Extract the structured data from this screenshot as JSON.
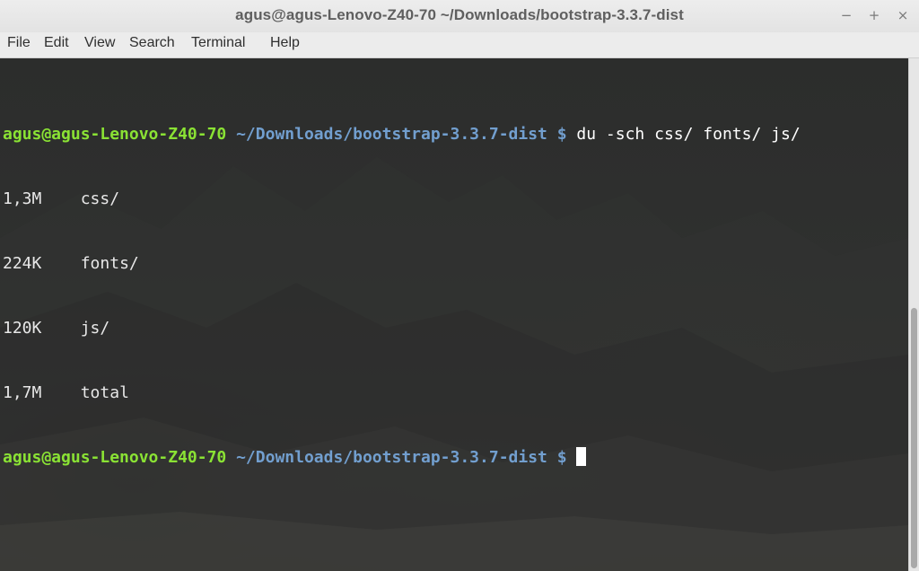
{
  "window": {
    "title": "agus@agus-Lenovo-Z40-70 ~/Downloads/bootstrap-3.3.7-dist",
    "controls": {
      "minimize": "−",
      "maximize": "+",
      "close": "×"
    }
  },
  "menubar": {
    "items": [
      "File",
      "Edit",
      "View",
      "Search",
      "Terminal",
      "Help"
    ]
  },
  "terminal": {
    "prompt": {
      "user_host": "agus@agus-Lenovo-Z40-70",
      "path": "~/Downloads/bootstrap-3.3.7-dist",
      "symbol": "$"
    },
    "command": "du -sch css/ fonts/ js/",
    "output": [
      {
        "size": "1,3M",
        "name": "css/"
      },
      {
        "size": "224K",
        "name": "fonts/"
      },
      {
        "size": "120K",
        "name": "js/"
      },
      {
        "size": "1,7M",
        "name": "total"
      }
    ],
    "colors": {
      "prompt_user": "#8ae234",
      "prompt_path": "#729fcf",
      "text": "#e8e8e8",
      "background": "#2e2f2e"
    }
  }
}
